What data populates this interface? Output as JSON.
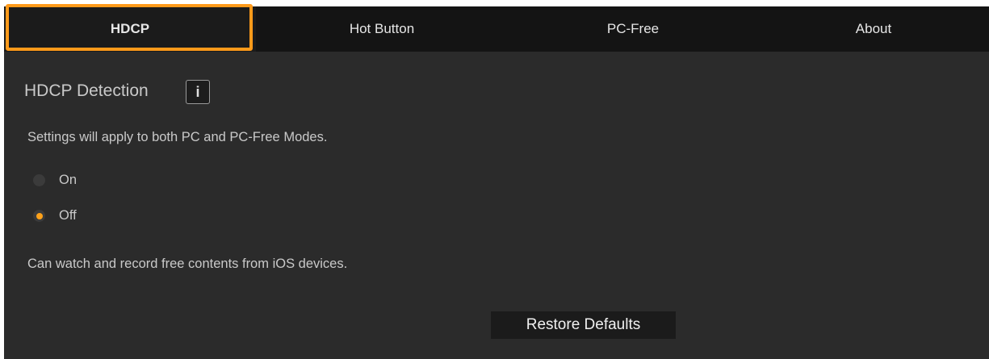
{
  "tabs": {
    "hdcp": "HDCP",
    "hot_button": "Hot Button",
    "pc_free": "PC-Free",
    "about": "About"
  },
  "active_tab": "HDCP",
  "section": {
    "title": "HDCP Detection",
    "info_icon_text": "i",
    "description": "Settings will apply to both PC and PC-Free Modes."
  },
  "options": {
    "on_label": "On",
    "off_label": "Off",
    "selected": "Off"
  },
  "note": "Can watch and record free contents from iOS devices.",
  "restore_button_label": "Restore Defaults",
  "colors": {
    "accent": "#ff9a1a",
    "background": "#2b2b2b",
    "tabbar": "#141414"
  }
}
